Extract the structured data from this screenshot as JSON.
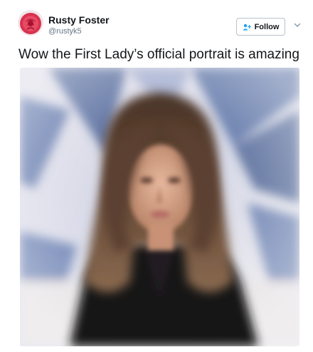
{
  "tweet": {
    "author": {
      "name": "Rusty Foster",
      "handle": "@rustyk5",
      "avatar_icon": "rose-avatar"
    },
    "follow_label": "Follow",
    "follow_icon": "add-person-icon",
    "more_icon": "chevron-down-icon",
    "text": "Wow the First Lady’s official portrait is amazing",
    "photo": {
      "subject": "portrait-photo"
    }
  },
  "colors": {
    "text": "#14171a",
    "secondary": "#657786",
    "accent": "#1da1f2",
    "border": "#b9c2cb"
  }
}
